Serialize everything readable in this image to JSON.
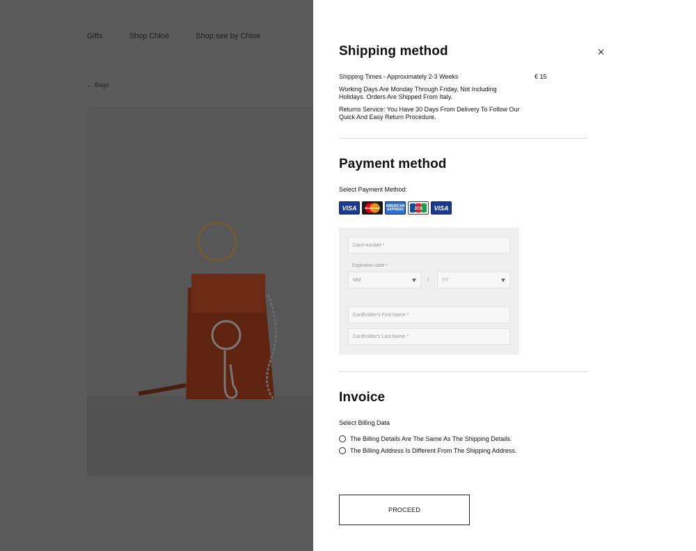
{
  "nav": {
    "items": [
      "Gifts",
      "Shop Chloé",
      "Shop see by Chloe"
    ],
    "back_label": "Bags"
  },
  "panel": {
    "shipping": {
      "title": "Shipping method",
      "times": "Shipping Times - Approximately 2-3 Weeks",
      "price": "€ 15",
      "working_days": "Working Days Are Monday Through Friday, Not Including Holidays. Orders Are Shipped From Italy.",
      "returns": "Returns Service: You Have 30 Days From Delivery To Follow Our Quick And Easy Return Procedure."
    },
    "payment": {
      "title": "Payment method",
      "select_label": "Select Payment Method:",
      "cards": [
        {
          "name": "visa",
          "label": "VISA"
        },
        {
          "name": "mastercard",
          "label": "MasterCard"
        },
        {
          "name": "amex",
          "label": "AMERICAN EXPRESS"
        },
        {
          "name": "jcb",
          "label": "JCB"
        },
        {
          "name": "visa-electron",
          "label": "VISA"
        }
      ],
      "card_number_placeholder": "Card number *",
      "expiration_label": "Expiration date *",
      "month_placeholder": "MM",
      "year_placeholder": "YY",
      "separator": "/",
      "first_name_placeholder": "Cardholder's First Name *",
      "last_name_placeholder": "Cardholder's Last Name *"
    },
    "invoice": {
      "title": "Invoice",
      "select_label": "Select Billing Data",
      "options": [
        "The Billing Details Are The Same As The Shipping Details.",
        "The Billing Address Is Different From The Shipping Address."
      ]
    },
    "proceed_label": "PROCEED"
  },
  "colors": {
    "overlay": "#5b5b5b",
    "panel": "#ffffff",
    "form_bg": "#efefef",
    "bag": "#6b2a14"
  }
}
